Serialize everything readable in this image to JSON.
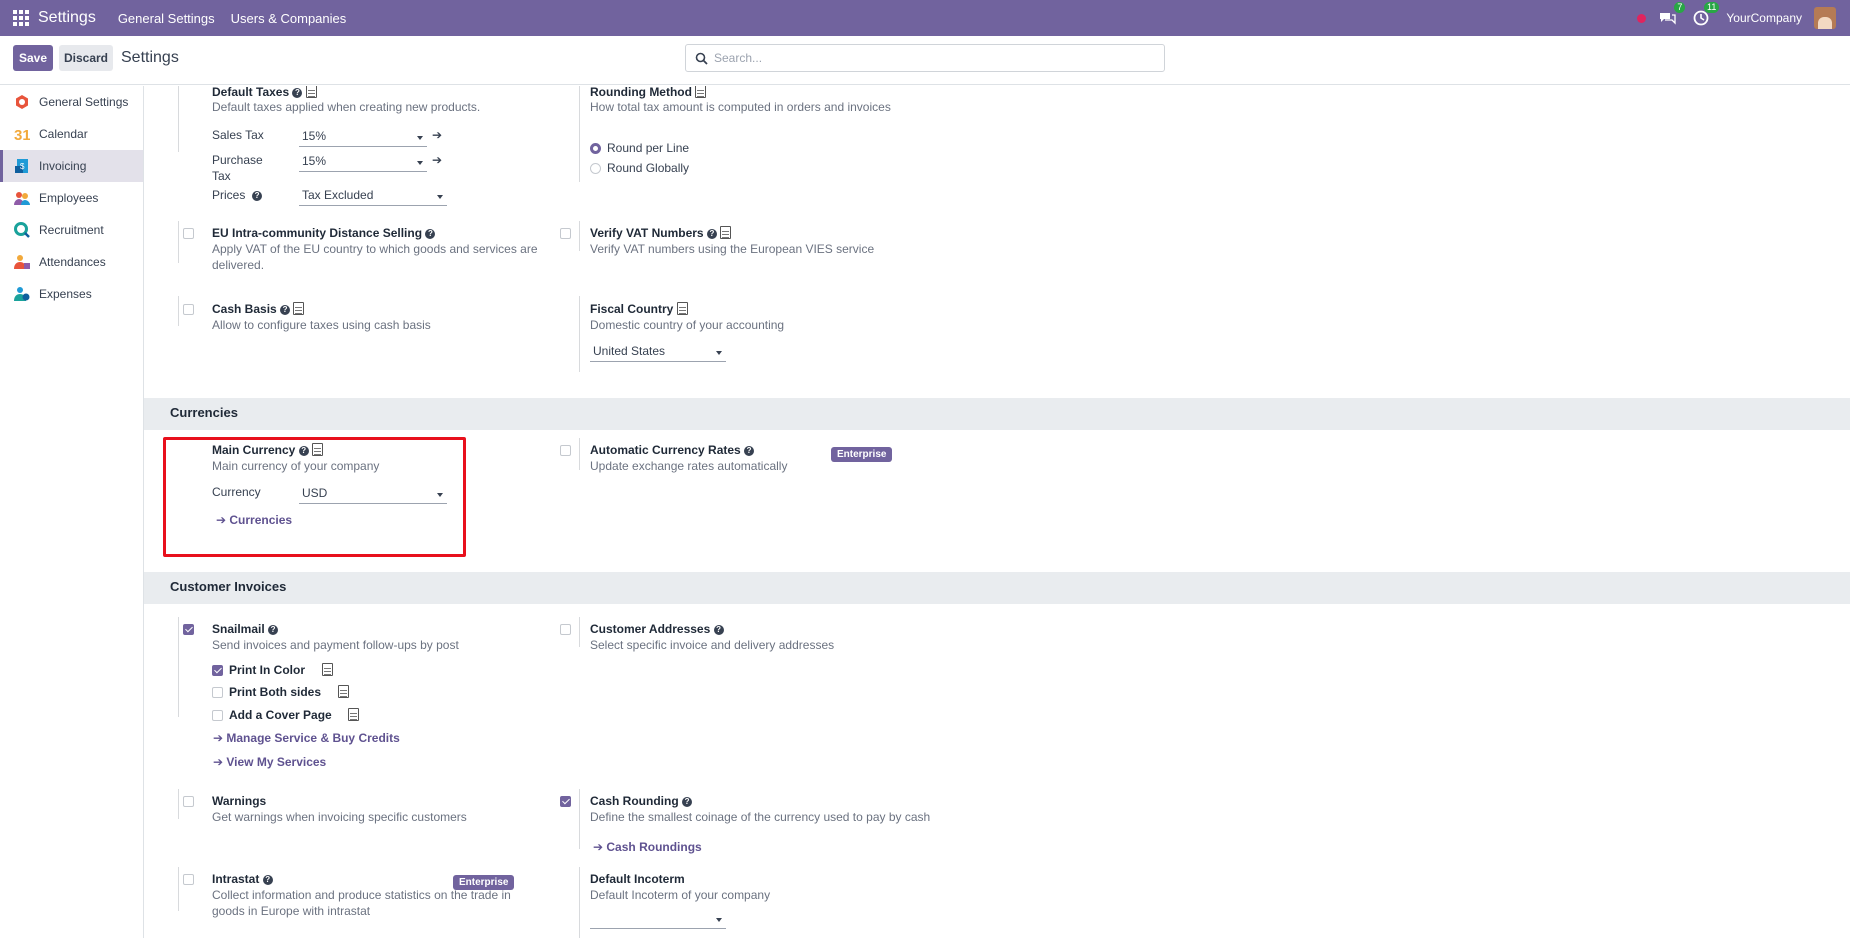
{
  "topbar": {
    "app": "Settings",
    "nav": [
      "General Settings",
      "Users & Companies"
    ],
    "chat_count": "7",
    "activity_count": "11",
    "company": "YourCompany"
  },
  "control": {
    "save": "Save",
    "discard": "Discard",
    "title": "Settings",
    "search_placeholder": "Search..."
  },
  "sidebar": [
    "General Settings",
    "Calendar",
    "Invoicing",
    "Employees",
    "Recruitment",
    "Attendances",
    "Expenses"
  ],
  "taxes": {
    "default_taxes": "Default Taxes",
    "default_taxes_desc": "Default taxes applied when creating new products.",
    "sales_tax_label": "Sales Tax",
    "sales_tax": "15%",
    "purchase_tax_label_1": "Purchase",
    "purchase_tax_label_2": "Tax",
    "purchase_tax": "15%",
    "prices_label": "Prices",
    "prices": "Tax Excluded",
    "rounding_method": "Rounding Method",
    "rounding_desc": "How total tax amount is computed in orders and invoices",
    "round_line": "Round per Line",
    "round_global": "Round Globally",
    "eu": "EU Intra-community Distance Selling",
    "eu_desc_1": "Apply VAT of the EU country to which goods and services are",
    "eu_desc_2": "delivered.",
    "vat": "Verify VAT Numbers",
    "vat_desc": "Verify VAT numbers using the European VIES service",
    "cash_basis": "Cash Basis",
    "cash_basis_desc": "Allow to configure taxes using cash basis",
    "fiscal": "Fiscal Country",
    "fiscal_desc": "Domestic country of your accounting",
    "fiscal_value": "United States"
  },
  "currencies": {
    "header": "Currencies",
    "main": "Main Currency",
    "main_desc": "Main currency of your company",
    "currency_label": "Currency",
    "currency_value": "USD",
    "link": "Currencies",
    "auto": "Automatic Currency Rates",
    "auto_desc": "Update exchange rates automatically",
    "enterprise": "Enterprise"
  },
  "invoices": {
    "header": "Customer Invoices",
    "snailmail": "Snailmail",
    "snailmail_desc": "Send invoices and payment follow-ups by post",
    "print_color": "Print In Color",
    "print_both": "Print Both sides",
    "cover": "Add a Cover Page",
    "manage": "Manage Service & Buy Credits",
    "view": "View My Services",
    "addresses": "Customer Addresses",
    "addresses_desc": "Select specific invoice and delivery addresses",
    "warnings": "Warnings",
    "warnings_desc": "Get warnings when invoicing specific customers",
    "cash_rounding": "Cash Rounding",
    "cash_rounding_desc": "Define the smallest coinage of the currency used to pay by cash",
    "cash_roundings_link": "Cash Roundings",
    "intrastat": "Intrastat",
    "intrastat_desc_1": "Collect information and produce statistics on the trade in",
    "intrastat_desc_2": "goods in Europe with intrastat",
    "enterprise": "Enterprise",
    "incoterm": "Default Incoterm",
    "incoterm_desc": "Default Incoterm of your company"
  },
  "colors": {
    "brand": "#71639e",
    "highlight": "#e8101c",
    "enterprise": "#71639e"
  }
}
